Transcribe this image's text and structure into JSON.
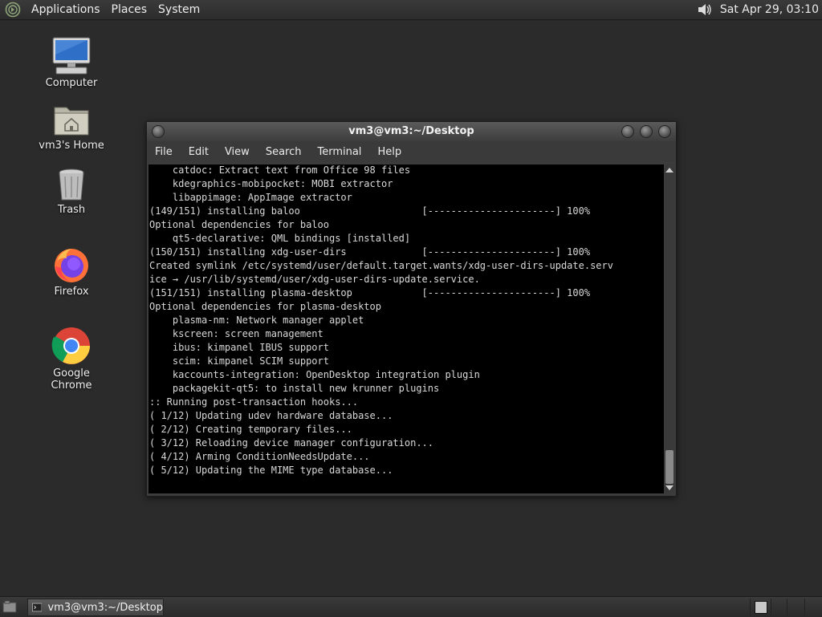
{
  "top_panel": {
    "menus": [
      "Applications",
      "Places",
      "System"
    ],
    "clock": "Sat Apr 29, 03:10"
  },
  "desktop_icons": [
    {
      "label": "Computer",
      "icon": "computer-icon"
    },
    {
      "label": "vm3's Home",
      "icon": "home-folder-icon"
    },
    {
      "label": "Trash",
      "icon": "trash-icon"
    },
    {
      "label": "Firefox",
      "icon": "firefox-icon"
    },
    {
      "label": "Google Chrome",
      "icon": "chrome-icon"
    }
  ],
  "terminal": {
    "title": "vm3@vm3:~/Desktop",
    "menus": [
      "File",
      "Edit",
      "View",
      "Search",
      "Terminal",
      "Help"
    ],
    "lines": [
      "    catdoc: Extract text from Office 98 files",
      "    kdegraphics-mobipocket: MOBI extractor",
      "    libappimage: AppImage extractor",
      "(149/151) installing baloo                     [----------------------] 100%",
      "Optional dependencies for baloo",
      "    qt5-declarative: QML bindings [installed]",
      "(150/151) installing xdg-user-dirs             [----------------------] 100%",
      "Created symlink /etc/systemd/user/default.target.wants/xdg-user-dirs-update.serv",
      "ice → /usr/lib/systemd/user/xdg-user-dirs-update.service.",
      "(151/151) installing plasma-desktop            [----------------------] 100%",
      "Optional dependencies for plasma-desktop",
      "    plasma-nm: Network manager applet",
      "    kscreen: screen management",
      "    ibus: kimpanel IBUS support",
      "    scim: kimpanel SCIM support",
      "    kaccounts-integration: OpenDesktop integration plugin",
      "    packagekit-qt5: to install new krunner plugins",
      ":: Running post-transaction hooks...",
      "( 1/12) Updating udev hardware database...",
      "( 2/12) Creating temporary files...",
      "( 3/12) Reloading device manager configuration...",
      "( 4/12) Arming ConditionNeedsUpdate...",
      "( 5/12) Updating the MIME type database..."
    ]
  },
  "taskbar": {
    "window_button_label": "vm3@vm3:~/Desktop"
  },
  "colors": {
    "desktop_bg": "#2b2b2b",
    "terminal_bg": "#000000",
    "terminal_fg": "#d8d8d8"
  }
}
